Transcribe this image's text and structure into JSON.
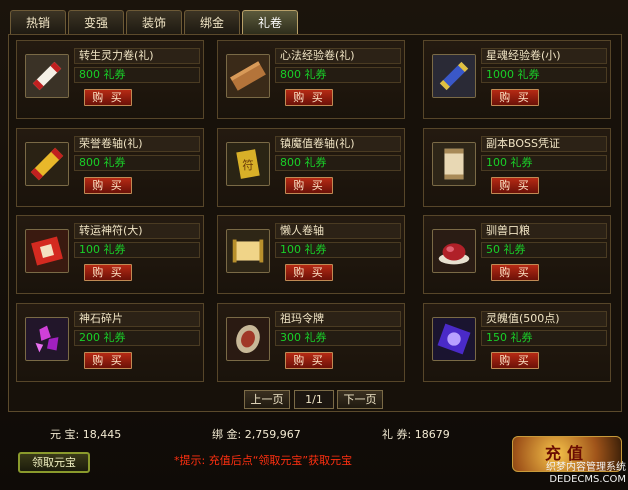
{
  "tabs": [
    {
      "label": "热销"
    },
    {
      "label": "变强"
    },
    {
      "label": "装饰"
    },
    {
      "label": "绑金"
    },
    {
      "label": "礼卷"
    }
  ],
  "active_tab": "礼卷",
  "items": [
    {
      "name": "转生灵力卷(礼)",
      "price": "800 礼券",
      "buy": "购 买",
      "icon": "scroll-icon"
    },
    {
      "name": "心法经验卷(礼)",
      "price": "800 礼券",
      "buy": "购 买",
      "icon": "wood-scroll-icon"
    },
    {
      "name": "星魂经验卷(小)",
      "price": "1000 礼券",
      "buy": "购 买",
      "icon": "blue-scroll-icon"
    },
    {
      "name": "荣誉卷轴(礼)",
      "price": "800 礼券",
      "buy": "购 买",
      "icon": "golden-scroll-icon"
    },
    {
      "name": "镇魔值卷轴(礼)",
      "price": "800 礼券",
      "buy": "购 买",
      "icon": "talisman-icon"
    },
    {
      "name": "副本BOSS凭证",
      "price": "100 礼券",
      "buy": "购 买",
      "icon": "certificate-icon"
    },
    {
      "name": "转运神符(大)",
      "price": "100 礼券",
      "buy": "购 买",
      "icon": "red-talisman-icon"
    },
    {
      "name": "懒人卷轴",
      "price": "100 礼券",
      "buy": "购 买",
      "icon": "open-scroll-icon"
    },
    {
      "name": "驯兽口粮",
      "price": "50 礼券",
      "buy": "购 买",
      "icon": "meat-icon"
    },
    {
      "name": "神石碎片",
      "price": "200 礼券",
      "buy": "购 买",
      "icon": "gem-shards-icon"
    },
    {
      "name": "祖玛令牌",
      "price": "300 礼券",
      "buy": "购 买",
      "icon": "token-icon"
    },
    {
      "name": "灵魄值(500点)",
      "price": "150 礼券",
      "buy": "购 买",
      "icon": "purple-orb-icon"
    }
  ],
  "pager": {
    "prev": "上一页",
    "page": "1/1",
    "next": "下一页"
  },
  "status": {
    "yuanbao_label": "元 宝:",
    "yuanbao_value": "18,445",
    "bangjin_label": "绑 金:",
    "bangjin_value": "2,759,967",
    "liquan_label": "礼 券:",
    "liquan_value": "18679"
  },
  "claim_button": "领取元宝",
  "tip": "*提示: 充值后点“领取元宝”获取元宝",
  "recharge_button": "充值",
  "watermark": {
    "line1": "织梦内容管理系统",
    "line2": "DEDECMS.COM"
  },
  "colors": {
    "price_green": "#19d028",
    "tip_red": "#ff3010",
    "buy_red": "#b62a14"
  }
}
